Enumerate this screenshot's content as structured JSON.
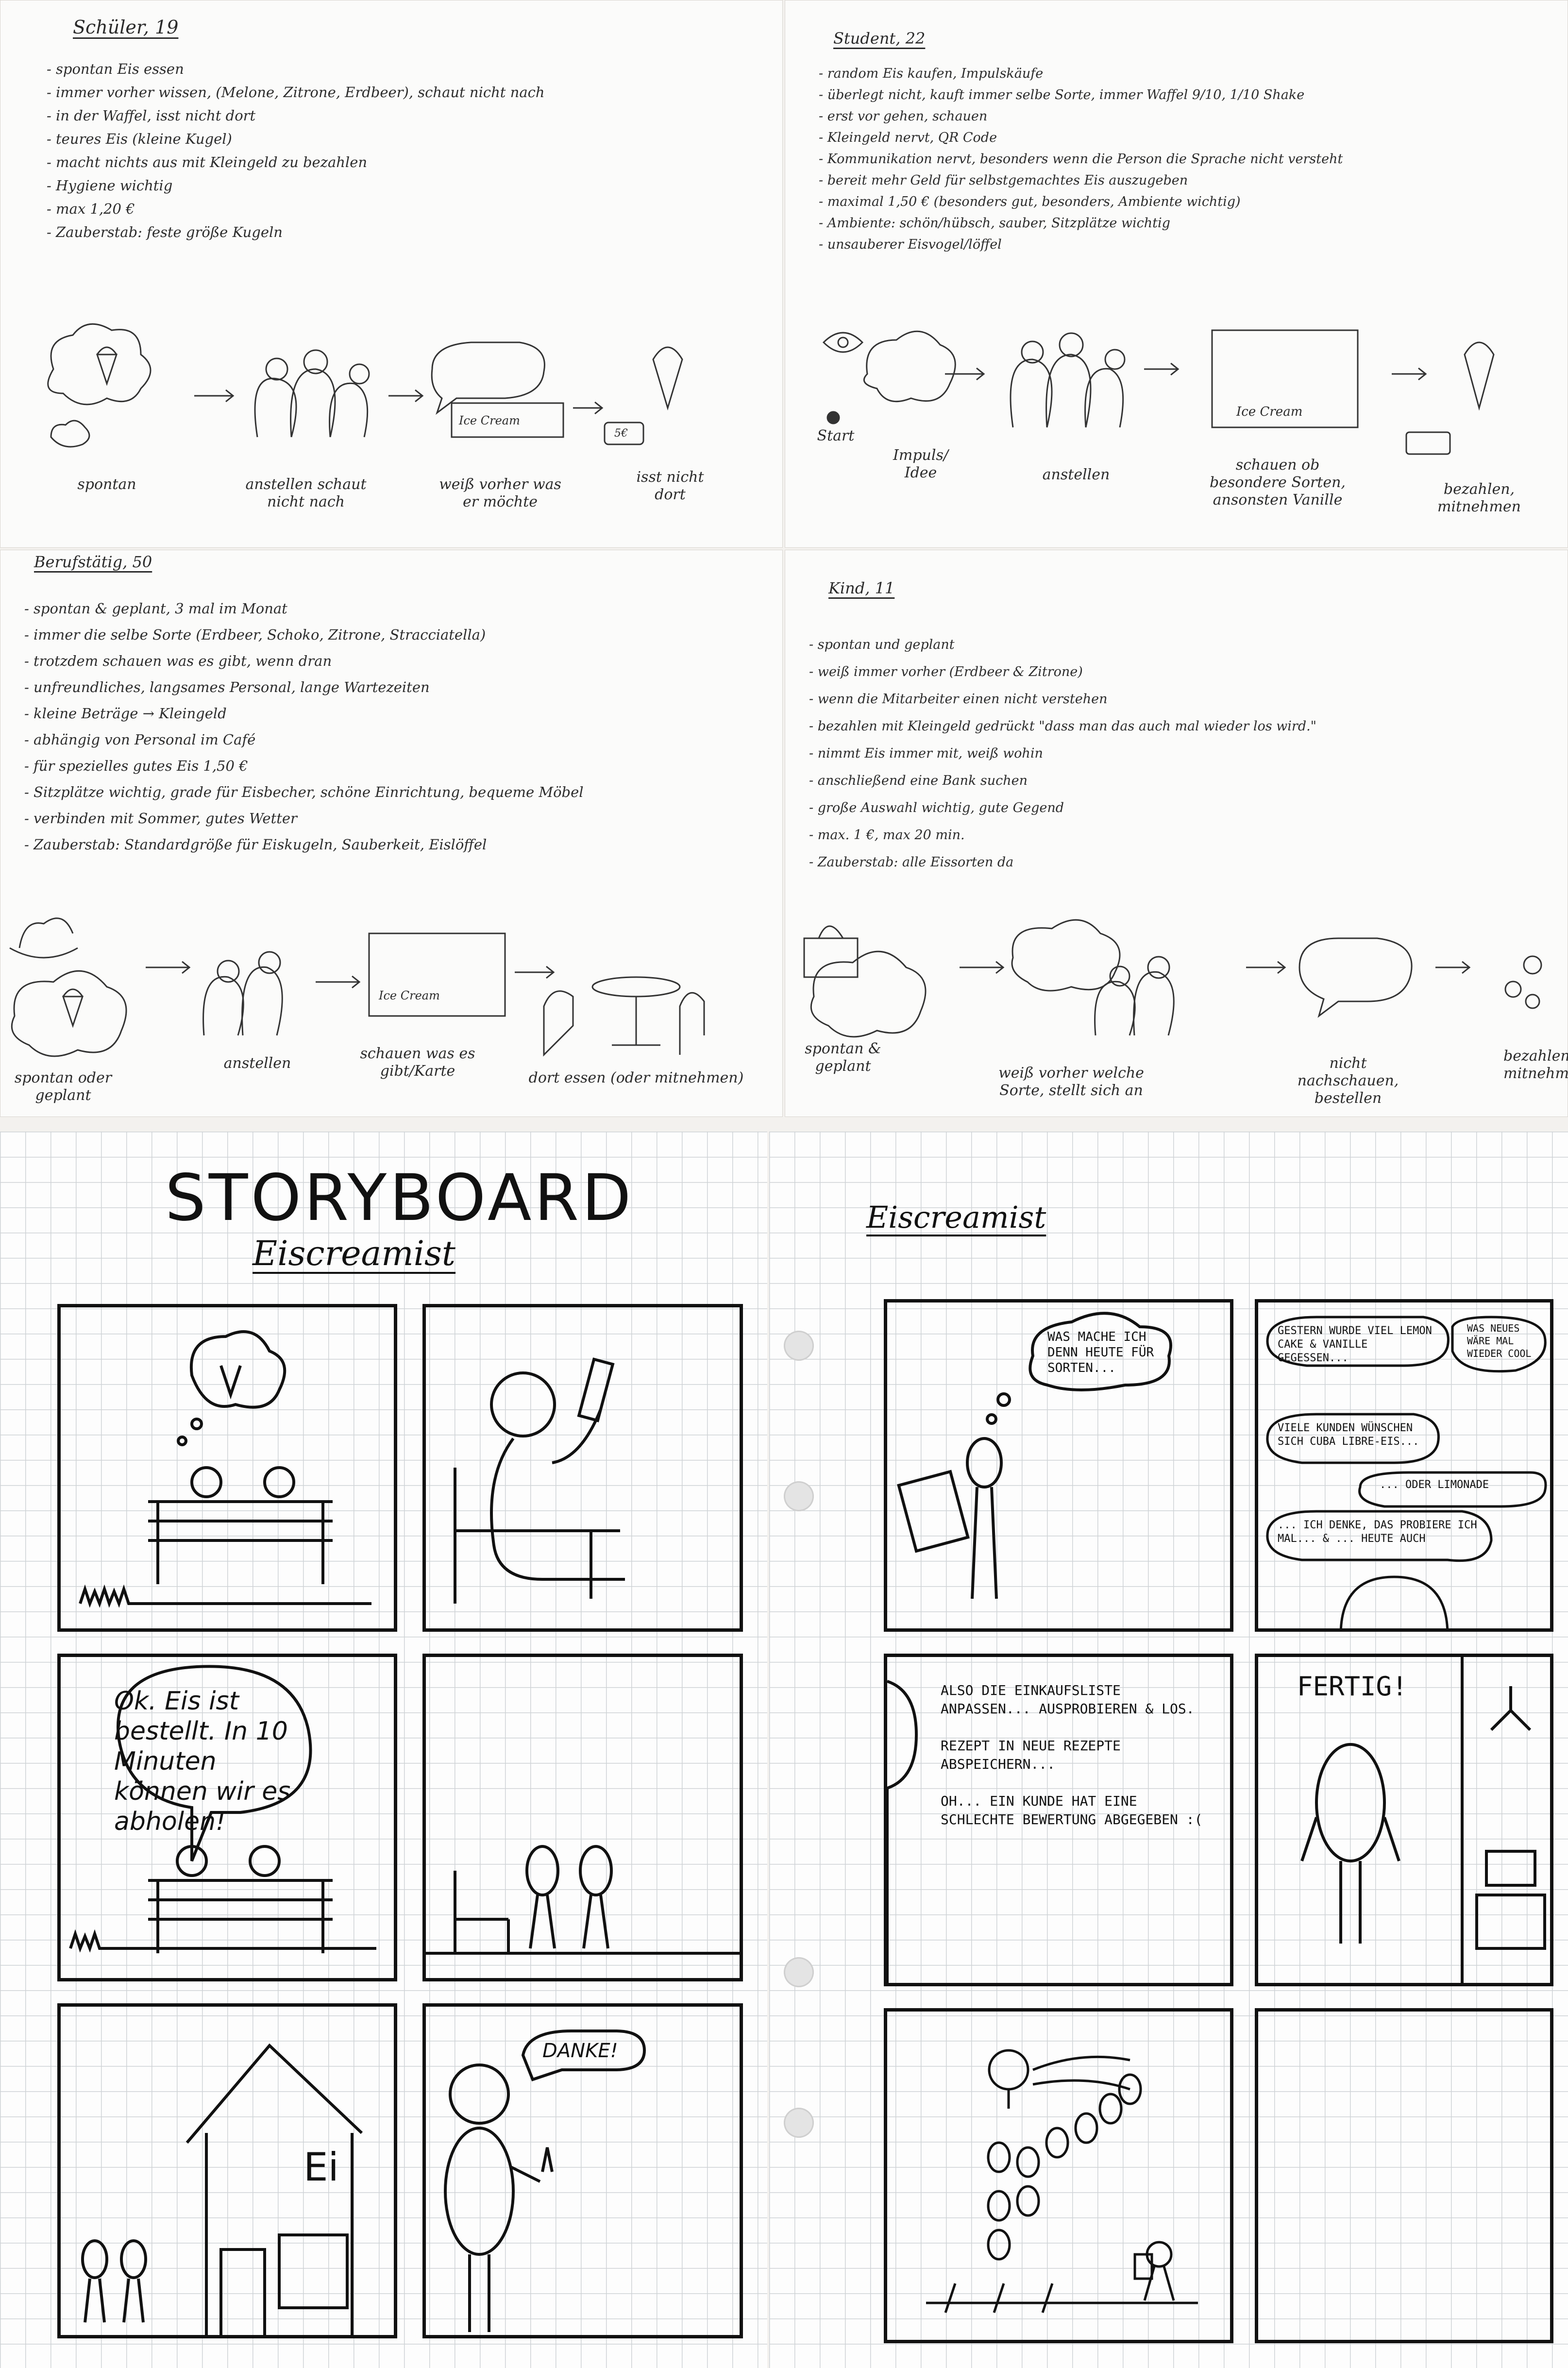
{
  "personas": [
    {
      "title": "Schüler, 19",
      "notes": [
        "spontan Eis essen",
        "immer vorher wissen, (Melone, Zitrone, Erdbeer), schaut nicht nach",
        "in der Waffel, isst nicht dort",
        "teures Eis (kleine Kugel)",
        "macht nichts aus mit Kleingeld zu bezahlen",
        "Hygiene wichtig",
        "max 1,20 €",
        "Zauberstab: feste größe Kugeln"
      ],
      "captions": [
        "spontan",
        "anstellen schaut nicht nach",
        "weiß vorher was er möchte",
        "isst nicht dort"
      ]
    },
    {
      "title": "Student, 22",
      "notes": [
        "random Eis kaufen, Impulskäufe",
        "überlegt nicht, kauft immer selbe Sorte, immer Waffel 9/10, 1/10 Shake",
        "erst vor gehen, schauen",
        "Kleingeld nervt, QR Code",
        "Kommunikation nervt, besonders wenn die Person die Sprache nicht versteht",
        "bereit mehr Geld für selbstgemachtes Eis auszugeben",
        "maximal 1,50 € (besonders gut, besonders, Ambiente wichtig)",
        "Ambiente: schön/hübsch, sauber, Sitzplätze wichtig",
        "unsauberer Eisvogel/löffel"
      ],
      "captions": [
        "Start",
        "Impuls/ Idee",
        "anstellen",
        "schauen ob besondere Sorten, ansonsten Vanille",
        "bezahlen, mitnehmen"
      ]
    },
    {
      "title": "Berufstätig, 50",
      "notes": [
        "spontan & geplant, 3 mal im Monat",
        "immer die selbe Sorte (Erdbeer, Schoko, Zitrone, Stracciatella)",
        "trotzdem schauen was es gibt, wenn dran",
        "unfreundliches, langsames Personal, lange Wartezeiten",
        "kleine Beträge → Kleingeld",
        "abhängig von Personal im Café",
        "für spezielles gutes Eis 1,50 €",
        "Sitzplätze wichtig, grade für Eisbecher, schöne Einrichtung, bequeme Möbel",
        "verbinden mit Sommer, gutes Wetter",
        "Zauberstab: Standardgröße für Eiskugeln, Sauberkeit, Eislöffel"
      ],
      "captions": [
        "spontan oder geplant",
        "anstellen",
        "schauen was es gibt/Karte",
        "dort essen (oder mitnehmen)"
      ]
    },
    {
      "title": "Kind, 11",
      "notes": [
        "spontan und geplant",
        "weiß immer vorher (Erdbeer & Zitrone)",
        "wenn die Mitarbeiter einen nicht verstehen",
        "bezahlen mit Kleingeld gedrückt \"dass man das auch mal wieder los wird.\"",
        "nimmt Eis immer mit, weiß wohin",
        "anschließend eine Bank suchen",
        "große Auswahl wichtig, gute Gegend",
        "max. 1 €, max 20 min.",
        "Zauberstab: alle Eissorten da"
      ],
      "captions": [
        "spontan & geplant",
        "weiß vorher welche Sorte, stellt sich an",
        "nicht nachschauen, bestellen",
        "bezahlen, mitnehmen"
      ]
    }
  ],
  "journey_labels": {
    "ice_cream_sign": "Ice Cream",
    "coin": "5€"
  },
  "storyboard": {
    "title": "STORYBOARD",
    "subtitle": "Eiscreamist",
    "speech_order": "Ok. Eis ist bestellt. In 10 Minuten können wir es abholen!",
    "speech_thanks": "DANKE!",
    "shop_sign": "Ei"
  },
  "storyboard2": {
    "subtitle": "Eiscreamist",
    "think_flavors": "WAS MACHE ICH DENN HEUTE FÜR SORTEN...",
    "speech_yesterday": "GESTERN WURDE VIEL LEMON CAKE & VANILLE GEGESSEN...",
    "speech_cool": "WAS NEUES WÄRE MAL WIEDER COOL",
    "speech_customers": "VIELE KUNDEN WÜNSCHEN SICH CUBA LIBRE-EIS...",
    "speech_lemonade": "... ODER LIMONADE",
    "speech_try": "... ICH DENKE, DAS PROBIERE ICH MAL... & ... HEUTE AUCH",
    "panel_text": "ALSO DIE EINKAUFSLISTE ANPASSEN... AUSPROBIEREN & LOS.\n\nREZEPT IN NEUE REZEPTE ABSPEICHERN...\n\nOH... EIN KUNDE HAT EINE SCHLECHTE BEWERTUNG ABGEGEBEN :(",
    "speech_done": "FERTIG!"
  },
  "colors": {
    "ink": "#111111",
    "pencil": "#3a3a3a",
    "paper": "#fbfbfa",
    "grid": "#cfd3d6"
  }
}
